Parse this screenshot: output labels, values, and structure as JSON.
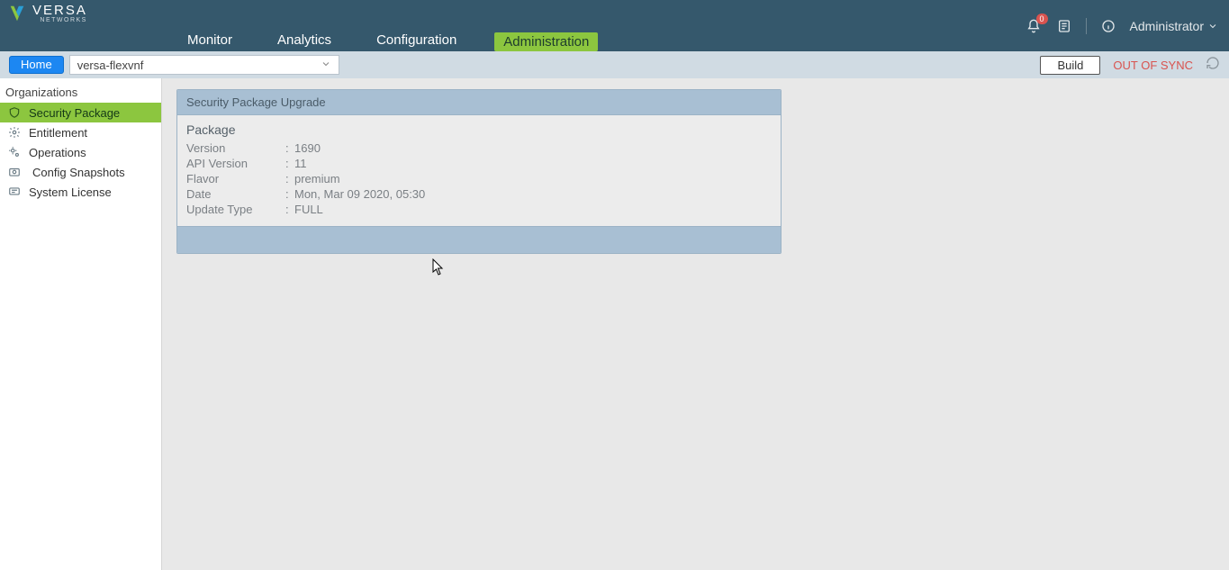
{
  "brand": {
    "name": "VERSA",
    "sub": "NETWORKS"
  },
  "nav": {
    "tabs": [
      {
        "label": "Monitor"
      },
      {
        "label": "Analytics"
      },
      {
        "label": "Configuration"
      },
      {
        "label": "Administration"
      }
    ],
    "active_index": 3
  },
  "top_right": {
    "bell_badge": "0",
    "user_label": "Administrator"
  },
  "secondbar": {
    "home_label": "Home",
    "device_value": "versa-flexvnf",
    "build_label": "Build",
    "status_text": "OUT OF SYNC"
  },
  "sidebar": {
    "heading": "Organizations",
    "items": [
      {
        "label": "Security Package"
      },
      {
        "label": "Entitlement"
      },
      {
        "label": "Operations"
      },
      {
        "label": "Config Snapshots"
      },
      {
        "label": "System License"
      }
    ],
    "active_index": 0
  },
  "panel": {
    "title": "Security Package Upgrade",
    "section_label": "Package",
    "rows": [
      {
        "key": "Version",
        "val": "1690"
      },
      {
        "key": "API Version",
        "val": "11"
      },
      {
        "key": "Flavor",
        "val": "premium"
      },
      {
        "key": "Date",
        "val": "Mon, Mar 09 2020, 05:30"
      },
      {
        "key": "Update Type",
        "val": "FULL"
      }
    ]
  }
}
